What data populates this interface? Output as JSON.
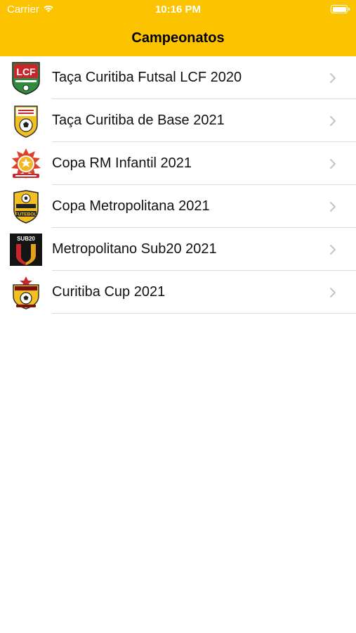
{
  "status": {
    "carrier": "Carrier",
    "time": "10:16 PM"
  },
  "navbar": {
    "title": "Campeonatos"
  },
  "championships": [
    {
      "label": "Taça Curitiba Futsal LCF 2020",
      "logo_icon": "lcf-shield-icon",
      "logo_text": "LCF"
    },
    {
      "label": "Taça Curitiba de Base 2021",
      "logo_icon": "base-shield-icon",
      "logo_text": ""
    },
    {
      "label": "Copa RM Infantil 2021",
      "logo_icon": "rm-infantil-crest-icon",
      "logo_text": ""
    },
    {
      "label": "Copa Metropolitana 2021",
      "logo_icon": "metropolitana-shield-icon",
      "logo_text": "FUTEBOL"
    },
    {
      "label": "Metropolitano Sub20 2021",
      "logo_icon": "sub20-badge-icon",
      "logo_text": "SUB20"
    },
    {
      "label": "Curitiba Cup 2021",
      "logo_icon": "curitiba-cup-crest-icon",
      "logo_text": ""
    }
  ],
  "colors": {
    "header": "#fcc400",
    "separator": "#dcdcdc",
    "chevron": "#c4c4c7"
  }
}
